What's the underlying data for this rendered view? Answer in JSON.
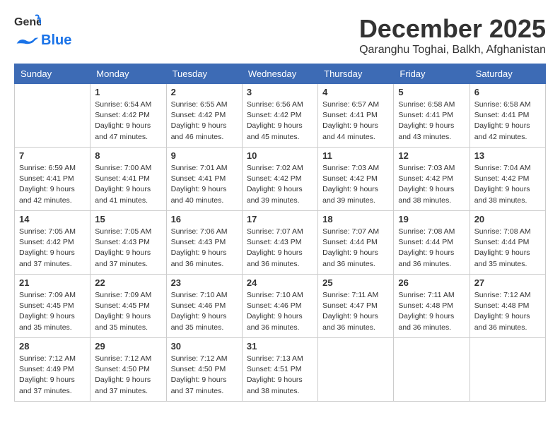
{
  "logo": {
    "line1": "General",
    "line2": "Blue"
  },
  "title": "December 2025",
  "location": "Qaranghu Toghai, Balkh, Afghanistan",
  "days_header": [
    "Sunday",
    "Monday",
    "Tuesday",
    "Wednesday",
    "Thursday",
    "Friday",
    "Saturday"
  ],
  "weeks": [
    [
      null,
      {
        "day": 1,
        "sunrise": "6:54 AM",
        "sunset": "4:42 PM",
        "daylight": "9 hours and 47 minutes."
      },
      {
        "day": 2,
        "sunrise": "6:55 AM",
        "sunset": "4:42 PM",
        "daylight": "9 hours and 46 minutes."
      },
      {
        "day": 3,
        "sunrise": "6:56 AM",
        "sunset": "4:42 PM",
        "daylight": "9 hours and 45 minutes."
      },
      {
        "day": 4,
        "sunrise": "6:57 AM",
        "sunset": "4:41 PM",
        "daylight": "9 hours and 44 minutes."
      },
      {
        "day": 5,
        "sunrise": "6:58 AM",
        "sunset": "4:41 PM",
        "daylight": "9 hours and 43 minutes."
      },
      {
        "day": 6,
        "sunrise": "6:58 AM",
        "sunset": "4:41 PM",
        "daylight": "9 hours and 42 minutes."
      }
    ],
    [
      {
        "day": 7,
        "sunrise": "6:59 AM",
        "sunset": "4:41 PM",
        "daylight": "9 hours and 42 minutes."
      },
      {
        "day": 8,
        "sunrise": "7:00 AM",
        "sunset": "4:41 PM",
        "daylight": "9 hours and 41 minutes."
      },
      {
        "day": 9,
        "sunrise": "7:01 AM",
        "sunset": "4:41 PM",
        "daylight": "9 hours and 40 minutes."
      },
      {
        "day": 10,
        "sunrise": "7:02 AM",
        "sunset": "4:42 PM",
        "daylight": "9 hours and 39 minutes."
      },
      {
        "day": 11,
        "sunrise": "7:03 AM",
        "sunset": "4:42 PM",
        "daylight": "9 hours and 39 minutes."
      },
      {
        "day": 12,
        "sunrise": "7:03 AM",
        "sunset": "4:42 PM",
        "daylight": "9 hours and 38 minutes."
      },
      {
        "day": 13,
        "sunrise": "7:04 AM",
        "sunset": "4:42 PM",
        "daylight": "9 hours and 38 minutes."
      }
    ],
    [
      {
        "day": 14,
        "sunrise": "7:05 AM",
        "sunset": "4:42 PM",
        "daylight": "9 hours and 37 minutes."
      },
      {
        "day": 15,
        "sunrise": "7:05 AM",
        "sunset": "4:43 PM",
        "daylight": "9 hours and 37 minutes."
      },
      {
        "day": 16,
        "sunrise": "7:06 AM",
        "sunset": "4:43 PM",
        "daylight": "9 hours and 36 minutes."
      },
      {
        "day": 17,
        "sunrise": "7:07 AM",
        "sunset": "4:43 PM",
        "daylight": "9 hours and 36 minutes."
      },
      {
        "day": 18,
        "sunrise": "7:07 AM",
        "sunset": "4:44 PM",
        "daylight": "9 hours and 36 minutes."
      },
      {
        "day": 19,
        "sunrise": "7:08 AM",
        "sunset": "4:44 PM",
        "daylight": "9 hours and 36 minutes."
      },
      {
        "day": 20,
        "sunrise": "7:08 AM",
        "sunset": "4:44 PM",
        "daylight": "9 hours and 35 minutes."
      }
    ],
    [
      {
        "day": 21,
        "sunrise": "7:09 AM",
        "sunset": "4:45 PM",
        "daylight": "9 hours and 35 minutes."
      },
      {
        "day": 22,
        "sunrise": "7:09 AM",
        "sunset": "4:45 PM",
        "daylight": "9 hours and 35 minutes."
      },
      {
        "day": 23,
        "sunrise": "7:10 AM",
        "sunset": "4:46 PM",
        "daylight": "9 hours and 35 minutes."
      },
      {
        "day": 24,
        "sunrise": "7:10 AM",
        "sunset": "4:46 PM",
        "daylight": "9 hours and 36 minutes."
      },
      {
        "day": 25,
        "sunrise": "7:11 AM",
        "sunset": "4:47 PM",
        "daylight": "9 hours and 36 minutes."
      },
      {
        "day": 26,
        "sunrise": "7:11 AM",
        "sunset": "4:48 PM",
        "daylight": "9 hours and 36 minutes."
      },
      {
        "day": 27,
        "sunrise": "7:12 AM",
        "sunset": "4:48 PM",
        "daylight": "9 hours and 36 minutes."
      }
    ],
    [
      {
        "day": 28,
        "sunrise": "7:12 AM",
        "sunset": "4:49 PM",
        "daylight": "9 hours and 37 minutes."
      },
      {
        "day": 29,
        "sunrise": "7:12 AM",
        "sunset": "4:50 PM",
        "daylight": "9 hours and 37 minutes."
      },
      {
        "day": 30,
        "sunrise": "7:12 AM",
        "sunset": "4:50 PM",
        "daylight": "9 hours and 37 minutes."
      },
      {
        "day": 31,
        "sunrise": "7:13 AM",
        "sunset": "4:51 PM",
        "daylight": "9 hours and 38 minutes."
      },
      null,
      null,
      null
    ]
  ],
  "labels": {
    "sunrise": "Sunrise:",
    "sunset": "Sunset:",
    "daylight": "Daylight:"
  }
}
